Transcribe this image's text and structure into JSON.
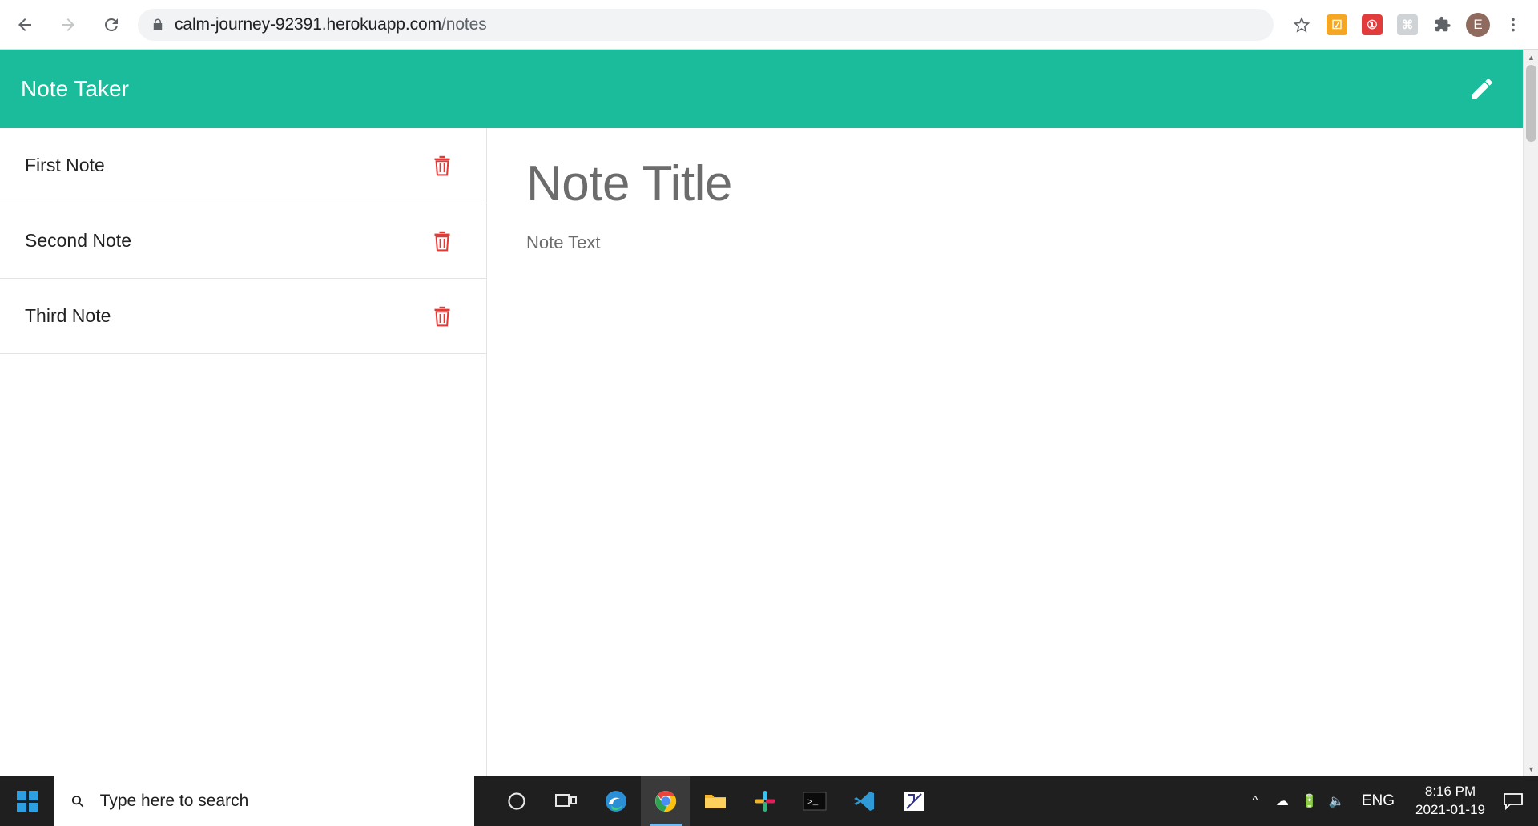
{
  "browser": {
    "back_icon": "arrow-left-icon",
    "forward_icon": "arrow-right-icon",
    "reload_icon": "reload-icon",
    "lock_icon": "lock-icon",
    "url_host": "calm-journey-92391.herokuapp.com",
    "url_path": "/notes",
    "star_icon": "star-icon",
    "extensions": [
      {
        "name": "extension-orange",
        "glyph": "☑",
        "color": "#f5a623"
      },
      {
        "name": "extension-lastpass",
        "glyph": "①",
        "color": "#e23b3b"
      },
      {
        "name": "extension-grey",
        "glyph": "⌘",
        "color": "#cfd3d6"
      }
    ],
    "puzzle_icon": "extensions-puzzle-icon",
    "profile_initial": "E",
    "menu_icon": "three-dot-menu-icon"
  },
  "app": {
    "title": "Note Taker",
    "accent_color": "#1bbc9b",
    "compose_icon": "pencil-icon",
    "notes": [
      {
        "label": "First Note",
        "delete_icon": "trash-icon"
      },
      {
        "label": "Second Note",
        "delete_icon": "trash-icon"
      },
      {
        "label": "Third Note",
        "delete_icon": "trash-icon"
      }
    ],
    "detail": {
      "title_placeholder": "Note Title",
      "text_placeholder": "Note Text",
      "title_value": "",
      "text_value": ""
    }
  },
  "scrollbar": {
    "up_arrow": "▲",
    "down_arrow": "▼"
  },
  "taskbar": {
    "start_icon": "windows-start-icon",
    "search_placeholder": "Type here to search",
    "search_icon": "search-icon",
    "apps": [
      {
        "name": "cortana-icon",
        "glyph": "○"
      },
      {
        "name": "task-view-icon",
        "glyph": "⌸"
      },
      {
        "name": "edge-icon",
        "glyph": "e"
      },
      {
        "name": "chrome-icon",
        "glyph": "◉"
      },
      {
        "name": "file-explorer-icon",
        "glyph": "὜0"
      },
      {
        "name": "slack-icon",
        "glyph": "✳"
      },
      {
        "name": "terminal-icon",
        "glyph": ">_"
      },
      {
        "name": "vscode-icon",
        "glyph": "⬚"
      },
      {
        "name": "insomnia-icon",
        "glyph": "◢"
      }
    ],
    "tray": {
      "chevron_up": "show-hidden-icons",
      "cloud_icon": "onedrive-icon",
      "battery_icon": "battery-icon",
      "volume_icon": "volume-icon",
      "language": "ENG",
      "time": "8:16 PM",
      "date": "2021-01-19",
      "notification_icon": "notifications-icon"
    }
  }
}
